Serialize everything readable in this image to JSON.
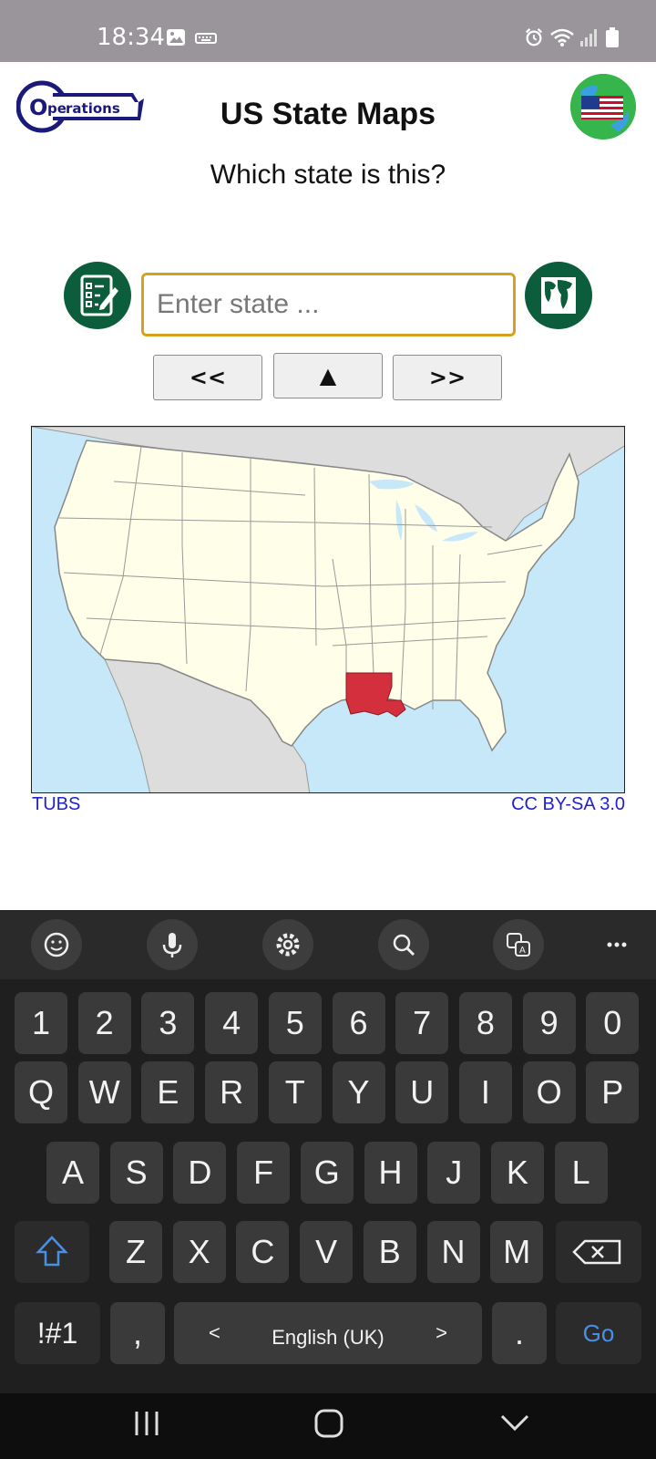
{
  "status_bar": {
    "time": "18:34",
    "left_icons": [
      "image-icon",
      "keyboard-icon"
    ],
    "right_icons": [
      "alarm-icon",
      "wifi-icon",
      "signal-icon",
      "battery-icon"
    ]
  },
  "header": {
    "logo_text": "Operations",
    "title": "US State Maps",
    "flag_button_icon": "us-flag-globe-icon"
  },
  "question": "Which state is this?",
  "input": {
    "placeholder": "Enter state ...",
    "value": "",
    "left_button_icon": "checklist-icon",
    "right_button_icon": "world-map-icon"
  },
  "nav": {
    "prev_label": "<<",
    "up_label": "▲",
    "next_label": ">>"
  },
  "map": {
    "highlighted_state_color": "#d32f3c",
    "credit_left": "TUBS",
    "credit_right": "CC BY-SA 3.0"
  },
  "keyboard": {
    "toolbar_icons": [
      "emoji-icon",
      "microphone-icon",
      "settings-icon",
      "search-icon",
      "translate-icon",
      "more-icon"
    ],
    "number_row": [
      "1",
      "2",
      "3",
      "4",
      "5",
      "6",
      "7",
      "8",
      "9",
      "0"
    ],
    "row1": [
      "Q",
      "W",
      "E",
      "R",
      "T",
      "Y",
      "U",
      "I",
      "O",
      "P"
    ],
    "row2": [
      "A",
      "S",
      "D",
      "F",
      "G",
      "H",
      "J",
      "K",
      "L"
    ],
    "row3": [
      "Z",
      "X",
      "C",
      "V",
      "B",
      "N",
      "M"
    ],
    "symbols_label": "!#1",
    "comma_label": ",",
    "space_label": "English (UK)",
    "space_left": "<",
    "space_right": ">",
    "period_label": ".",
    "go_label": "Go"
  },
  "colors": {
    "accent_green": "#0b5d3b",
    "input_border": "#d4a21b",
    "credit_link": "#2222cc"
  }
}
